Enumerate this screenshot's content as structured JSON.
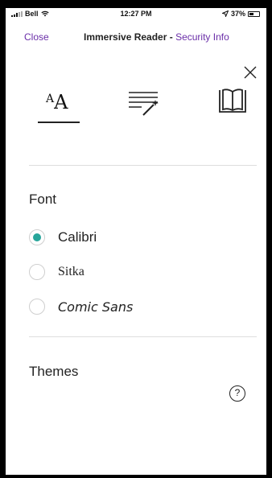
{
  "status_bar": {
    "carrier": "Bell",
    "time": "12:27 PM",
    "battery": "37%",
    "icons": [
      "signal-icon",
      "wifi-icon",
      "location-arrow-icon",
      "battery-icon"
    ]
  },
  "nav": {
    "close_label": "Close",
    "title": "Immersive Reader -",
    "title_accent": "Security Info"
  },
  "tabs": [
    {
      "name": "text-preferences",
      "icon": "text-size-icon",
      "selected": true
    },
    {
      "name": "grammar-options",
      "icon": "grammar-wand-icon",
      "selected": false
    },
    {
      "name": "reading-preferences",
      "icon": "book-icon",
      "selected": false
    }
  ],
  "font_section": {
    "title": "Font",
    "options": [
      {
        "label": "Calibri",
        "selected": true
      },
      {
        "label": "Sitka",
        "selected": false
      },
      {
        "label": "Comic Sans",
        "selected": false
      }
    ]
  },
  "themes_section": {
    "title": "Themes",
    "help_label": "?"
  },
  "colors": {
    "accent": "#6a2ea8",
    "radio_selected": "#27a59a"
  }
}
